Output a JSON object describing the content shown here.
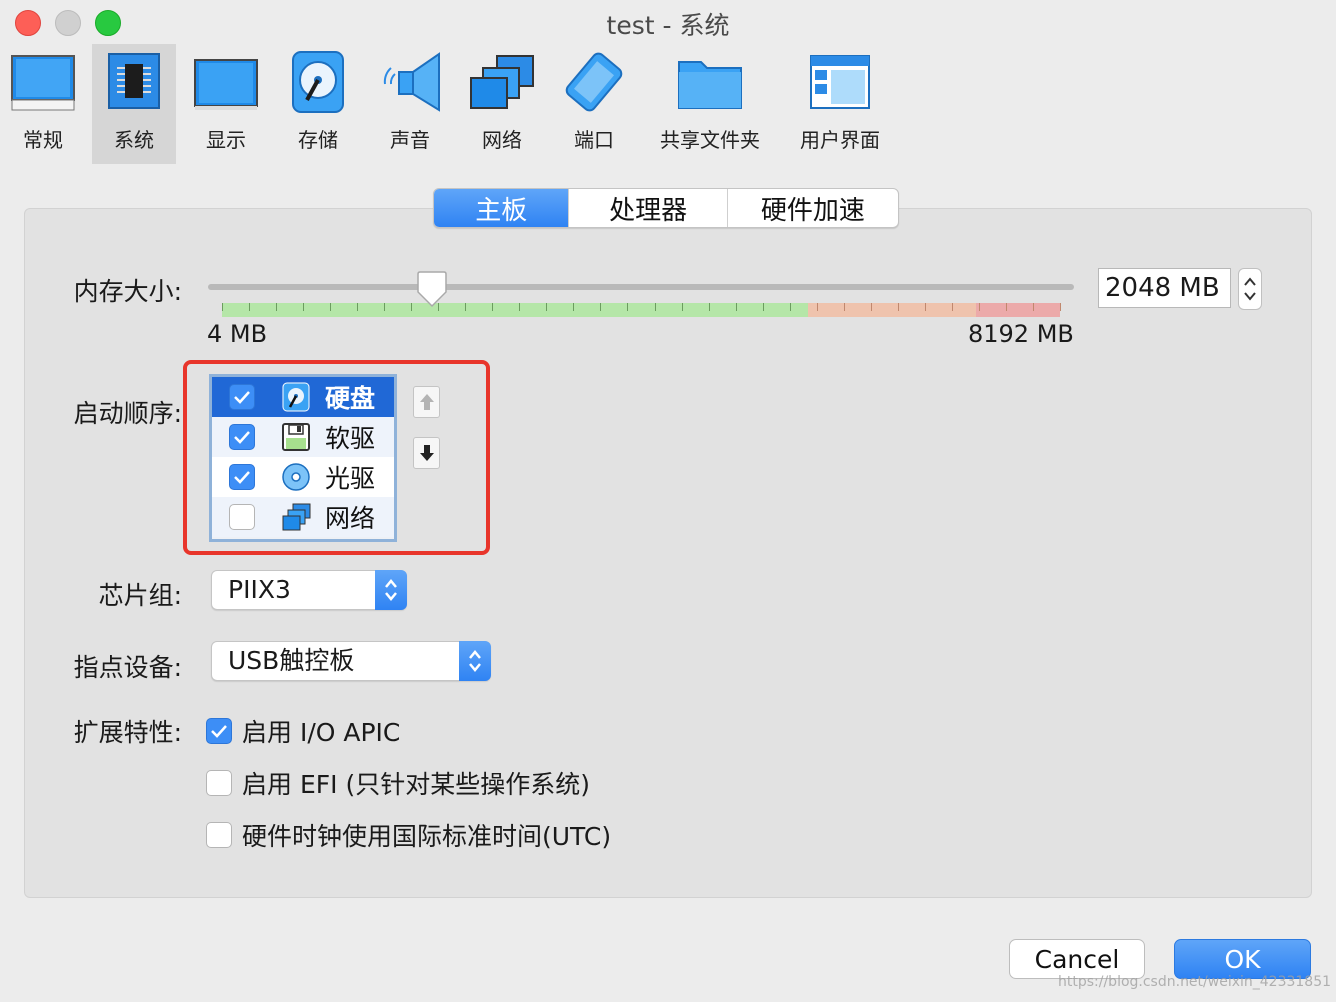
{
  "window": {
    "title": "test - 系统"
  },
  "toolbar": {
    "items": [
      {
        "label": "常规",
        "icon": "monitor-general-icon"
      },
      {
        "label": "系统",
        "icon": "chip-icon"
      },
      {
        "label": "显示",
        "icon": "display-icon"
      },
      {
        "label": "存储",
        "icon": "storage-disk-icon"
      },
      {
        "label": "声音",
        "icon": "speaker-icon"
      },
      {
        "label": "网络",
        "icon": "network-icon"
      },
      {
        "label": "端口",
        "icon": "serial-port-icon"
      },
      {
        "label": "共享文件夹",
        "icon": "shared-folder-icon"
      },
      {
        "label": "用户界面",
        "icon": "user-interface-icon"
      }
    ],
    "active": "系统"
  },
  "tabs": [
    "主板",
    "处理器",
    "硬件加速"
  ],
  "active_tab": "主板",
  "memory": {
    "label": "内存大小:",
    "value": "2048 MB",
    "min_label": "4 MB",
    "max_label": "8192 MB",
    "fraction": 0.25
  },
  "boot_order": {
    "label": "启动顺序:",
    "items": [
      {
        "label": "硬盘",
        "checked": true,
        "selected": true
      },
      {
        "label": "软驱",
        "checked": true,
        "selected": false
      },
      {
        "label": "光驱",
        "checked": true,
        "selected": false
      },
      {
        "label": "网络",
        "checked": false,
        "selected": false
      }
    ]
  },
  "chipset": {
    "label": "芯片组:",
    "value": "PIIX3"
  },
  "pointing_device": {
    "label": "指点设备:",
    "value": "USB触控板"
  },
  "extended": {
    "label": "扩展特性:",
    "options": [
      {
        "label": "启用 I/O APIC",
        "checked": true
      },
      {
        "label": "启用 EFI (只针对某些操作系统)",
        "checked": false
      },
      {
        "label": "硬件时钟使用国际标准时间(UTC)",
        "checked": false
      }
    ]
  },
  "buttons": {
    "cancel": "Cancel",
    "ok": "OK"
  },
  "watermark": "https://blog.csdn.net/weixin_42331851",
  "colors": {
    "accent": "#2f83f3",
    "highlight_border": "#e8352b",
    "selected_row": "#2068d6"
  }
}
